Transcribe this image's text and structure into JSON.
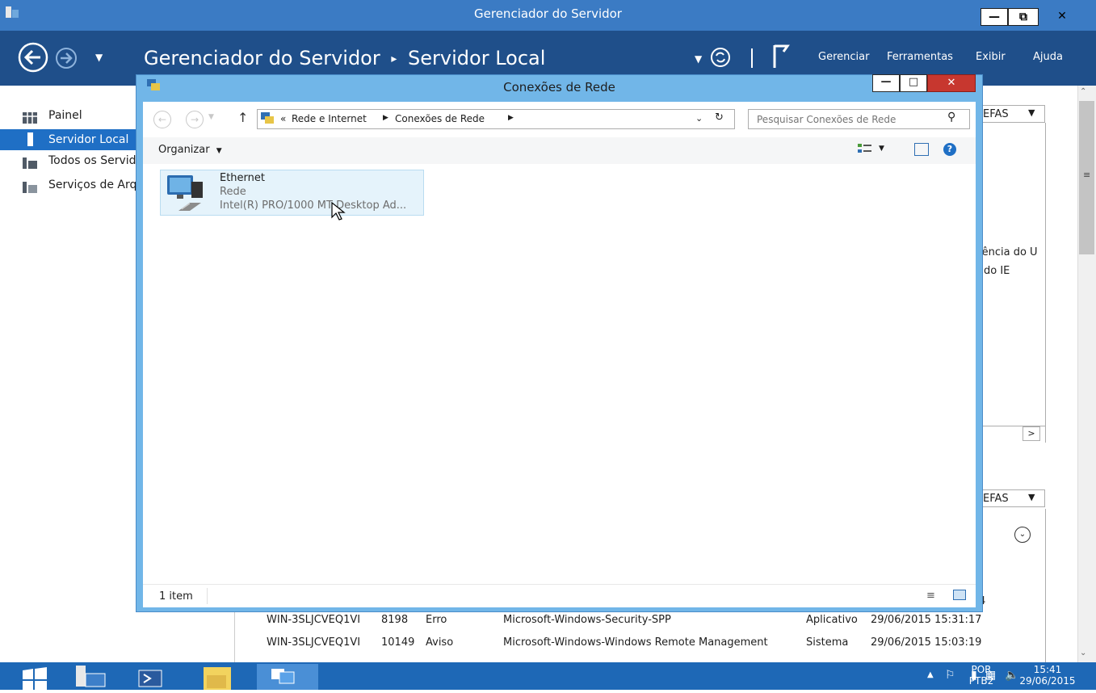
{
  "server_manager": {
    "window_title": "Gerenciador do Servidor",
    "breadcrumb_root": "Gerenciador do Servidor",
    "breadcrumb_sep": "▸",
    "breadcrumb_current": "Servidor Local",
    "menu": [
      "Gerenciar",
      "Ferramentas",
      "Exibir",
      "Ajuda"
    ],
    "sidebar": [
      {
        "label": "Painel",
        "icon": "dashboard-icon"
      },
      {
        "label": "Servidor Local",
        "icon": "server-icon"
      },
      {
        "label": "Todos os Servidores",
        "icon": "servers-icon"
      },
      {
        "label": "Serviços de Arquivo e Armazenamento",
        "icon": "file-services-icon"
      }
    ],
    "right_panel": {
      "tasks_label": "EFAS",
      "tasks_label_2": "EFAS",
      "text_1": "iência do U",
      "text_2": "do IE"
    },
    "events": [
      {
        "server": "WIN-3SLJCVEQ1VI",
        "id": "8198",
        "severity": "Erro",
        "source": "Microsoft-Windows-Security-SPP",
        "log": "Aplicativo",
        "date": "29/06/2015 15:31:17"
      },
      {
        "server": "WIN-3SLJCVEQ1VI",
        "id": "10149",
        "severity": "Aviso",
        "source": "Microsoft-Windows-Windows Remote Management",
        "log": "Sistema",
        "date": "29/06/2015 15:03:19"
      }
    ],
    "partial_digit": "4"
  },
  "network_connections": {
    "title": "Conexões de Rede",
    "address": {
      "prefix": "«",
      "path_1": "Rede e Internet",
      "path_2": "Conexões de Rede"
    },
    "search_placeholder": "Pesquisar Conexões de Rede",
    "organize_label": "Organizar",
    "item": {
      "name": "Ethernet",
      "status": "Rede",
      "device": "Intel(R) PRO/1000 MT Desktop Ad..."
    },
    "status_text": "1 item"
  },
  "taskbar": {
    "language": "POR",
    "keyboard": "PTB2",
    "time": "15:41",
    "date": "29/06/2015"
  },
  "colors": {
    "titlebar": "#3b7bc4",
    "header": "#1f4f8a",
    "explorer_frame": "#71b6e8",
    "taskbar": "#1e68b6",
    "selection": "#e5f3fb"
  }
}
